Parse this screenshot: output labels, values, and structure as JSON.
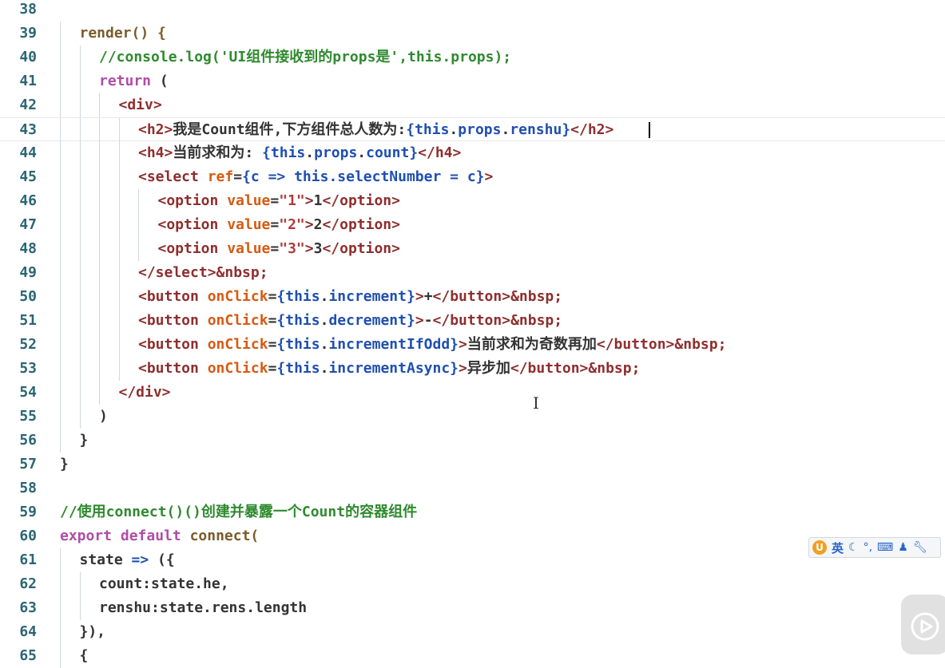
{
  "editor": {
    "lines": [
      {
        "no": "38",
        "indent": 0,
        "tokens": []
      },
      {
        "no": "39",
        "indent": 1,
        "tokens": [
          {
            "t": "render() {",
            "c": "t-fn"
          }
        ]
      },
      {
        "no": "40",
        "indent": 2,
        "tokens": [
          {
            "t": "//console.log('UI组件接收到的props是',this.props);",
            "c": "t-cm"
          }
        ]
      },
      {
        "no": "41",
        "indent": 2,
        "tokens": [
          {
            "t": "return",
            "c": "t-kw"
          },
          {
            "t": " (",
            "c": "t-txt"
          }
        ]
      },
      {
        "no": "42",
        "indent": 3,
        "tokens": [
          {
            "t": "<div>",
            "c": "t-tag"
          }
        ]
      },
      {
        "no": "43",
        "indent": 4,
        "current": true,
        "tokens": [
          {
            "t": "<h2>",
            "c": "t-tag"
          },
          {
            "t": "我是Count组件,下方组件总人数为:",
            "c": "t-txt"
          },
          {
            "t": "{",
            "c": "t-brace"
          },
          {
            "t": "this",
            "c": "t-var"
          },
          {
            "t": ".",
            "c": "t-txt"
          },
          {
            "t": "props",
            "c": "t-var"
          },
          {
            "t": ".",
            "c": "t-txt"
          },
          {
            "t": "renshu",
            "c": "t-var"
          },
          {
            "t": "}",
            "c": "t-brace"
          },
          {
            "t": "</h2>",
            "c": "t-tag"
          }
        ]
      },
      {
        "no": "44",
        "indent": 4,
        "tokens": [
          {
            "t": "<h4>",
            "c": "t-tag"
          },
          {
            "t": "当前求和为: ",
            "c": "t-txt"
          },
          {
            "t": "{",
            "c": "t-brace"
          },
          {
            "t": "this",
            "c": "t-var"
          },
          {
            "t": ".",
            "c": "t-txt"
          },
          {
            "t": "props",
            "c": "t-var"
          },
          {
            "t": ".",
            "c": "t-txt"
          },
          {
            "t": "count",
            "c": "t-var"
          },
          {
            "t": "}",
            "c": "t-brace"
          },
          {
            "t": "</h4>",
            "c": "t-tag"
          }
        ]
      },
      {
        "no": "45",
        "indent": 4,
        "tokens": [
          {
            "t": "<select",
            "c": "t-tag"
          },
          {
            "t": " ",
            "c": "t-txt"
          },
          {
            "t": "ref",
            "c": "t-attr"
          },
          {
            "t": "=",
            "c": "t-txt"
          },
          {
            "t": "{",
            "c": "t-brace"
          },
          {
            "t": "c => this.selectNumber = c",
            "c": "t-var"
          },
          {
            "t": "}",
            "c": "t-brace"
          },
          {
            "t": ">",
            "c": "t-tag"
          }
        ]
      },
      {
        "no": "46",
        "indent": 5,
        "tokens": [
          {
            "t": "<option",
            "c": "t-tag"
          },
          {
            "t": " ",
            "c": "t-txt"
          },
          {
            "t": "value",
            "c": "t-attr"
          },
          {
            "t": "=",
            "c": "t-txt"
          },
          {
            "t": "\"1\"",
            "c": "t-str"
          },
          {
            "t": ">",
            "c": "t-tag"
          },
          {
            "t": "1",
            "c": "t-txt"
          },
          {
            "t": "</option>",
            "c": "t-tag"
          }
        ]
      },
      {
        "no": "47",
        "indent": 5,
        "tokens": [
          {
            "t": "<option",
            "c": "t-tag"
          },
          {
            "t": " ",
            "c": "t-txt"
          },
          {
            "t": "value",
            "c": "t-attr"
          },
          {
            "t": "=",
            "c": "t-txt"
          },
          {
            "t": "\"2\"",
            "c": "t-str"
          },
          {
            "t": ">",
            "c": "t-tag"
          },
          {
            "t": "2",
            "c": "t-txt"
          },
          {
            "t": "</option>",
            "c": "t-tag"
          }
        ]
      },
      {
        "no": "48",
        "indent": 5,
        "tokens": [
          {
            "t": "<option",
            "c": "t-tag"
          },
          {
            "t": " ",
            "c": "t-txt"
          },
          {
            "t": "value",
            "c": "t-attr"
          },
          {
            "t": "=",
            "c": "t-txt"
          },
          {
            "t": "\"3\"",
            "c": "t-str"
          },
          {
            "t": ">",
            "c": "t-tag"
          },
          {
            "t": "3",
            "c": "t-txt"
          },
          {
            "t": "</option>",
            "c": "t-tag"
          }
        ]
      },
      {
        "no": "49",
        "indent": 4,
        "tokens": [
          {
            "t": "</select>",
            "c": "t-tag"
          },
          {
            "t": "&nbsp;",
            "c": "t-tag"
          }
        ]
      },
      {
        "no": "50",
        "indent": 4,
        "tokens": [
          {
            "t": "<button",
            "c": "t-tag"
          },
          {
            "t": " ",
            "c": "t-txt"
          },
          {
            "t": "onClick",
            "c": "t-attr"
          },
          {
            "t": "=",
            "c": "t-txt"
          },
          {
            "t": "{",
            "c": "t-brace"
          },
          {
            "t": "this",
            "c": "t-var"
          },
          {
            "t": ".",
            "c": "t-txt"
          },
          {
            "t": "increment",
            "c": "t-var"
          },
          {
            "t": "}",
            "c": "t-brace"
          },
          {
            "t": ">",
            "c": "t-tag"
          },
          {
            "t": "+",
            "c": "t-txt"
          },
          {
            "t": "</button>",
            "c": "t-tag"
          },
          {
            "t": "&nbsp;",
            "c": "t-tag"
          }
        ]
      },
      {
        "no": "51",
        "indent": 4,
        "tokens": [
          {
            "t": "<button",
            "c": "t-tag"
          },
          {
            "t": " ",
            "c": "t-txt"
          },
          {
            "t": "onClick",
            "c": "t-attr"
          },
          {
            "t": "=",
            "c": "t-txt"
          },
          {
            "t": "{",
            "c": "t-brace"
          },
          {
            "t": "this",
            "c": "t-var"
          },
          {
            "t": ".",
            "c": "t-txt"
          },
          {
            "t": "decrement",
            "c": "t-var"
          },
          {
            "t": "}",
            "c": "t-brace"
          },
          {
            "t": ">",
            "c": "t-tag"
          },
          {
            "t": "-",
            "c": "t-txt"
          },
          {
            "t": "</button>",
            "c": "t-tag"
          },
          {
            "t": "&nbsp;",
            "c": "t-tag"
          }
        ]
      },
      {
        "no": "52",
        "indent": 4,
        "tokens": [
          {
            "t": "<button",
            "c": "t-tag"
          },
          {
            "t": " ",
            "c": "t-txt"
          },
          {
            "t": "onClick",
            "c": "t-attr"
          },
          {
            "t": "=",
            "c": "t-txt"
          },
          {
            "t": "{",
            "c": "t-brace"
          },
          {
            "t": "this",
            "c": "t-var"
          },
          {
            "t": ".",
            "c": "t-txt"
          },
          {
            "t": "incrementIfOdd",
            "c": "t-var"
          },
          {
            "t": "}",
            "c": "t-brace"
          },
          {
            "t": ">",
            "c": "t-tag"
          },
          {
            "t": "当前求和为奇数再加",
            "c": "t-txt"
          },
          {
            "t": "</button>",
            "c": "t-tag"
          },
          {
            "t": "&nbsp;",
            "c": "t-tag"
          }
        ]
      },
      {
        "no": "53",
        "indent": 4,
        "tokens": [
          {
            "t": "<button",
            "c": "t-tag"
          },
          {
            "t": " ",
            "c": "t-txt"
          },
          {
            "t": "onClick",
            "c": "t-attr"
          },
          {
            "t": "=",
            "c": "t-txt"
          },
          {
            "t": "{",
            "c": "t-brace"
          },
          {
            "t": "this",
            "c": "t-var"
          },
          {
            "t": ".",
            "c": "t-txt"
          },
          {
            "t": "incrementAsync",
            "c": "t-var"
          },
          {
            "t": "}",
            "c": "t-brace"
          },
          {
            "t": ">",
            "c": "t-tag"
          },
          {
            "t": "异步加",
            "c": "t-txt"
          },
          {
            "t": "</button>",
            "c": "t-tag"
          },
          {
            "t": "&nbsp;",
            "c": "t-tag"
          }
        ]
      },
      {
        "no": "54",
        "indent": 3,
        "tokens": [
          {
            "t": "</div>",
            "c": "t-tag"
          }
        ]
      },
      {
        "no": "55",
        "indent": 2,
        "tokens": [
          {
            "t": ")",
            "c": "t-txt"
          }
        ]
      },
      {
        "no": "56",
        "indent": 1,
        "tokens": [
          {
            "t": "}",
            "c": "t-txt"
          }
        ]
      },
      {
        "no": "57",
        "indent": 0,
        "tokens": [
          {
            "t": "}",
            "c": "t-txt"
          }
        ]
      },
      {
        "no": "58",
        "indent": 0,
        "tokens": []
      },
      {
        "no": "59",
        "indent": 0,
        "tokens": [
          {
            "t": "//使用connect()()创建并暴露一个Count的容器组件",
            "c": "t-cm"
          }
        ]
      },
      {
        "no": "60",
        "indent": 0,
        "tokens": [
          {
            "t": "export",
            "c": "t-kw"
          },
          {
            "t": " ",
            "c": "t-txt"
          },
          {
            "t": "default",
            "c": "t-kw"
          },
          {
            "t": " ",
            "c": "t-txt"
          },
          {
            "t": "connect(",
            "c": "t-fn"
          }
        ]
      },
      {
        "no": "61",
        "indent": 1,
        "tokens": [
          {
            "t": "state",
            "c": "t-txt"
          },
          {
            "t": " => ",
            "c": "t-var"
          },
          {
            "t": "({",
            "c": "t-txt"
          }
        ]
      },
      {
        "no": "62",
        "indent": 2,
        "tokens": [
          {
            "t": "count:state.he,",
            "c": "t-txt"
          }
        ]
      },
      {
        "no": "63",
        "indent": 2,
        "tokens": [
          {
            "t": "renshu:state.rens.length",
            "c": "t-txt"
          }
        ]
      },
      {
        "no": "64",
        "indent": 1,
        "tokens": [
          {
            "t": "}),",
            "c": "t-txt"
          }
        ]
      },
      {
        "no": "65",
        "indent": 1,
        "tokens": [
          {
            "t": "{",
            "c": "t-txt"
          }
        ]
      }
    ]
  },
  "ime_toolbar": {
    "logo_icon": "ime-logo-icon",
    "language": "英",
    "icons": [
      "moon-icon",
      "punctuation-icon",
      "keyboard-icon",
      "user-icon",
      "wrench-icon"
    ]
  },
  "overlay": {
    "play_icon": "play-icon"
  }
}
